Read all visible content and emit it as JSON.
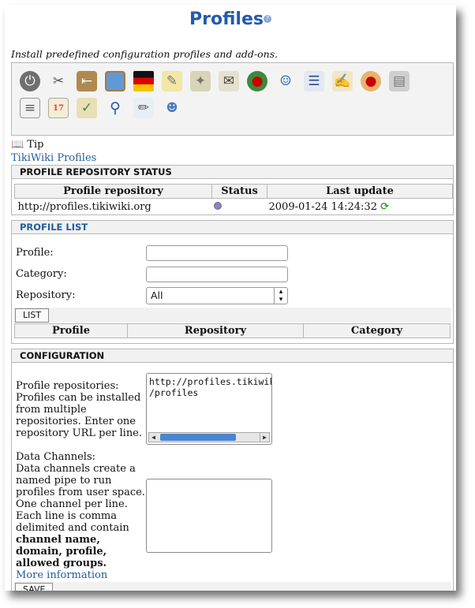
{
  "header": {
    "title": "Profiles",
    "help_icon": "help-icon"
  },
  "description": "Install predefined configuration profiles and add-ons.",
  "toolbar_icons_row1": [
    "power",
    "tools",
    "exit-door",
    "image-frame",
    "german-flag",
    "notepad",
    "puzzle",
    "mail-postcard",
    "globe-pin",
    "users",
    "newspaper",
    "edit-form",
    "palette",
    "folders"
  ],
  "toolbar_icons_row2": [
    "document",
    "calendar",
    "clipboard",
    "magnifier",
    "edit-shapes",
    "user-share"
  ],
  "tip": {
    "label": "Tip",
    "link": "TikiWiki Profiles"
  },
  "repo_status": {
    "heading": "PROFILE REPOSITORY STATUS",
    "columns": [
      "Profile repository",
      "Status",
      "Last update"
    ],
    "rows": [
      {
        "repository": "http://profiles.tikiwiki.org",
        "last_update": "2009-01-24 14:24:32"
      }
    ]
  },
  "profile_list": {
    "heading": "PROFILE LIST",
    "profile_label": "Profile:",
    "profile_value": "",
    "category_label": "Category:",
    "category_value": "",
    "repository_label": "Repository:",
    "repository_selected": "All",
    "list_button": "LIST",
    "columns": [
      "Profile",
      "Repository",
      "Category"
    ]
  },
  "configuration": {
    "heading": "CONFIGURATION",
    "repos_label": "Profile repositories:",
    "repos_help": "Profiles can be installed from multiple repositories. Enter one repository URL per line.",
    "repos_value_line1": "http://profiles.tikiwiki.org",
    "repos_value_line2": "/profiles",
    "channels_label": "Data Channels:",
    "channels_help": "Data channels create a named pipe to run profiles from user space. One channel per line. Each line is comma delimited and contain",
    "channels_bold": "channel name, domain, profile, allowed groups.",
    "more_info": "More information",
    "channels_value": "",
    "save_button": "SAVE"
  }
}
